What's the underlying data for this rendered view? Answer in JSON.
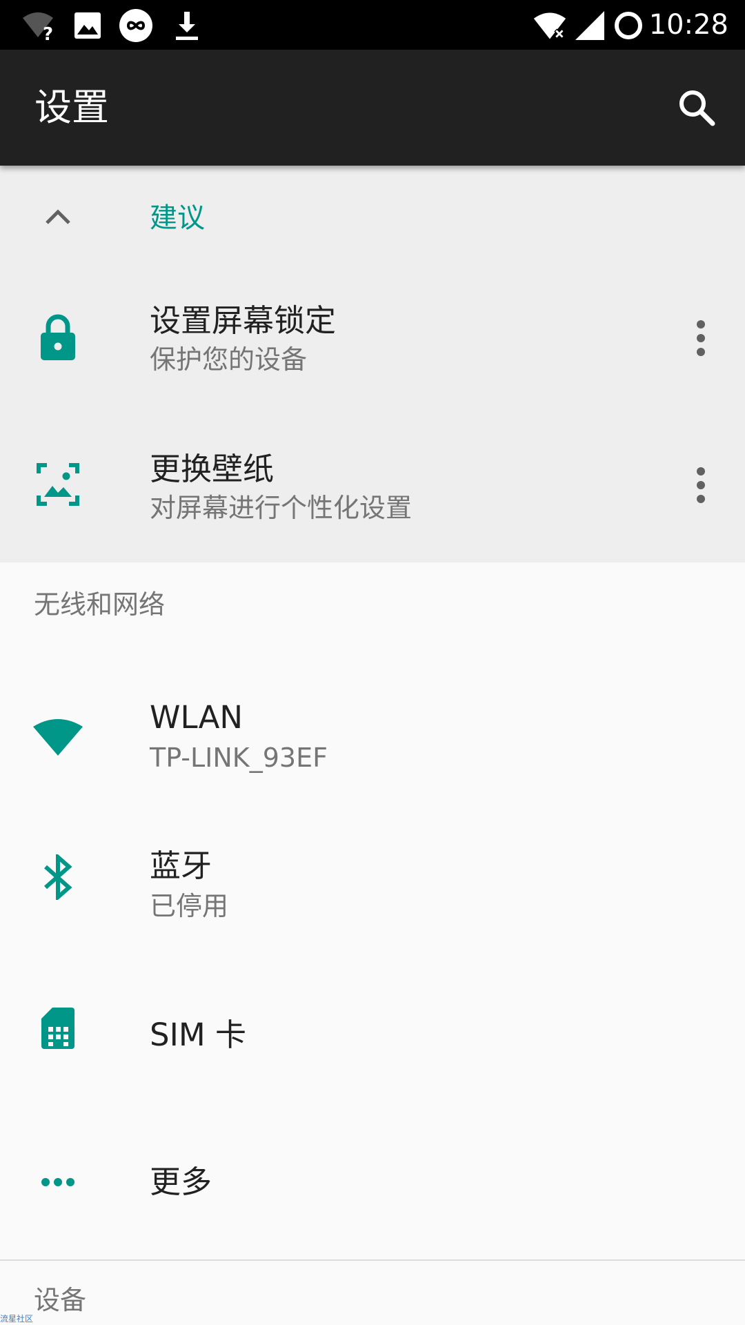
{
  "status_bar": {
    "time": "10:28",
    "left_icons": [
      "wifi-question-icon",
      "image-icon",
      "infinity-icon",
      "download-icon"
    ],
    "right_icons": [
      "wifi-off-icon",
      "signal-icon",
      "sync-ring-icon"
    ]
  },
  "toolbar": {
    "title": "设置",
    "search_icon": "search-icon"
  },
  "suggestions": {
    "header": "建议",
    "items": [
      {
        "title": "设置屏幕锁定",
        "subtitle": "保护您的设备",
        "icon": "lock-icon"
      },
      {
        "title": "更换壁纸",
        "subtitle": "对屏幕进行个性化设置",
        "icon": "wallpaper-icon"
      }
    ]
  },
  "wireless": {
    "header": "无线和网络",
    "items": [
      {
        "title": "WLAN",
        "subtitle": "TP-LINK_93EF",
        "icon": "wifi-icon"
      },
      {
        "title": "蓝牙",
        "subtitle": "已停用",
        "icon": "bluetooth-icon"
      },
      {
        "title": "SIM 卡",
        "icon": "sim-card-icon"
      },
      {
        "title": "更多",
        "icon": "more-horiz-icon"
      }
    ]
  },
  "device": {
    "header": "设备"
  },
  "watermark": "流星社区",
  "colors": {
    "accent": "#009688",
    "toolbar": "#212121",
    "status_bar": "#000000",
    "suggestion_bg": "#eeeeee",
    "background": "#fafafa"
  }
}
